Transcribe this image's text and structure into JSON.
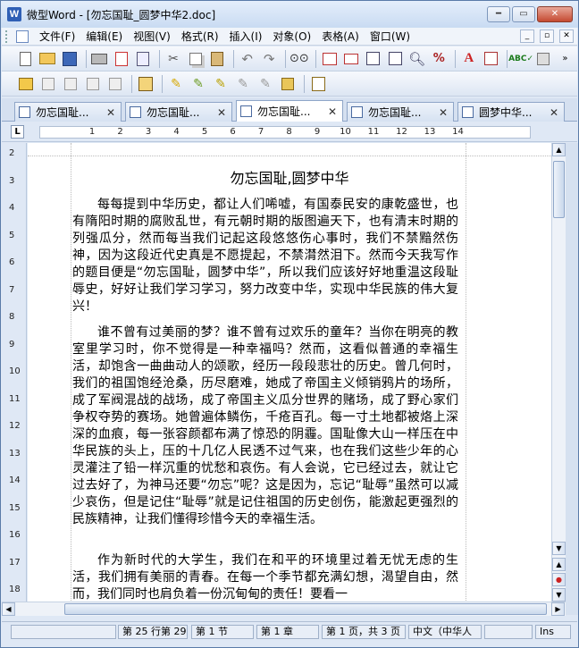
{
  "window": {
    "title": "微型Word - [勿忘国耻_圆梦中华2.doc]",
    "app_icon": "W"
  },
  "menu": [
    "文件(F)",
    "编辑(E)",
    "视图(V)",
    "格式(R)",
    "插入(I)",
    "对象(O)",
    "表格(A)",
    "窗口(W)"
  ],
  "tabs": [
    {
      "label": "勿忘国耻...",
      "active": false
    },
    {
      "label": "勿忘国耻...",
      "active": false
    },
    {
      "label": "勿忘国耻...",
      "active": true
    },
    {
      "label": "勿忘国耻...",
      "active": false
    },
    {
      "label": "圆梦中华...",
      "active": false
    }
  ],
  "ruler": {
    "corner": "L",
    "ticks": [
      "1",
      "2",
      "3",
      "4",
      "5",
      "6",
      "7",
      "8",
      "9",
      "10",
      "11",
      "12",
      "13",
      "14"
    ]
  },
  "vruler": {
    "numbers": [
      "2",
      "3",
      "4",
      "5",
      "6",
      "7",
      "8",
      "9",
      "10",
      "11",
      "12",
      "13",
      "14",
      "15",
      "16",
      "17",
      "18"
    ]
  },
  "document": {
    "title": "勿忘国耻,圆梦中华",
    "paragraphs": [
      "每每提到中华历史，都让人们唏嘘，有国泰民安的康乾盛世，也有隋阳时期的腐败乱世，有元朝时期的版图遍天下，也有清末时期的列强瓜分，然而每当我们记起这段悠悠伤心事时，我们不禁黯然伤神，因为这段近代史真是不愿提起，不禁潸然泪下。然而今天我写作的题目便是“勿忘国耻，圆梦中华”，所以我们应该好好地重温这段耻辱史，好好让我们学习学习，努力改变中华，实现中华民族的伟大复兴！",
      "谁不曾有过美丽的梦？谁不曾有过欢乐的童年？当你在明亮的教室里学习时，你不觉得是一种幸福吗？然而，这看似普通的幸福生活，却饱含一曲曲动人的颂歌，经历一段段悲壮的历史。曾几何时，我们的祖国饱经沧桑，历尽磨难，她成了帝国主义倾销鸦片的场所，成了军阀混战的战场，成了帝国主义瓜分世界的赌场，成了野心家们争权夺势的赛场。她曾遍体鳞伤，千疮百孔。每一寸土地都被烙上深深的血痕，每一张容颜都布满了惊恐的阴霾。国耻像大山一样压在中华民族的头上，压的十几亿人民透不过气来，也在我们这些少年的心灵灌注了铅一样沉重的忧愁和哀伤。有人会说，它已经过去，就让它过去好了，为神马还要“勿忘”呢？这是因为，忘记“耻辱”虽然可以减少哀伤，但是记住“耻辱”就是记住祖国的历史创伤，能激起更强烈的民族精神，让我们懂得珍惜今天的幸福生活。",
      "作为新时代的大学生，我们在和平的环境里过着无忧无虑的生活，我们拥有美丽的青春。在每一个季节都充满幻想，渴望自由，然而，我们同时也肩负着一份沉甸甸的责任！要看一"
    ]
  },
  "status": {
    "position": "第 25 行第 29",
    "section": "第 1 节",
    "chapter": "第 1 章",
    "pages": "第 1 页，共 3 页",
    "language": "中文（中华人",
    "mode": "Ins"
  },
  "colors": {
    "chrome": "#dfe8f5",
    "title_bar": "#c9dbf2",
    "close": "#c54a31",
    "page": "#ffffff"
  }
}
